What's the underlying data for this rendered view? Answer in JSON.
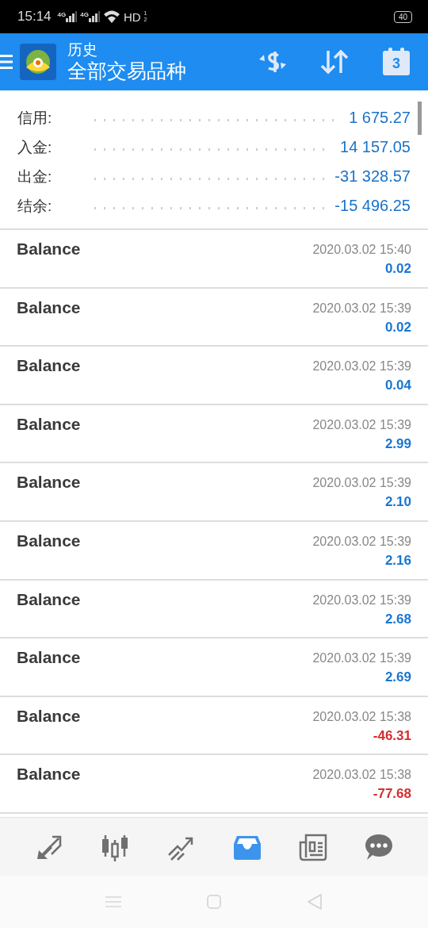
{
  "status_bar": {
    "time": "15:14",
    "signals": [
      "4G",
      "4G"
    ],
    "hd": "HD",
    "sims": [
      "1",
      "2"
    ],
    "battery": "40"
  },
  "header": {
    "title": "历史",
    "subtitle": "全部交易品种",
    "calendar_day": "3"
  },
  "summary": [
    {
      "label": "信用:",
      "value": "1 675.27"
    },
    {
      "label": "入金:",
      "value": "14 157.05"
    },
    {
      "label": "出金:",
      "value": "-31 328.57"
    },
    {
      "label": "结余:",
      "value": "-15 496.25"
    }
  ],
  "deals": [
    {
      "type": "Balance",
      "time": "2020.03.02 15:40",
      "amount": "0.02",
      "color": "#1976d2"
    },
    {
      "type": "Balance",
      "time": "2020.03.02 15:39",
      "amount": "0.02",
      "color": "#1976d2"
    },
    {
      "type": "Balance",
      "time": "2020.03.02 15:39",
      "amount": "0.04",
      "color": "#1976d2"
    },
    {
      "type": "Balance",
      "time": "2020.03.02 15:39",
      "amount": "2.99",
      "color": "#1976d2"
    },
    {
      "type": "Balance",
      "time": "2020.03.02 15:39",
      "amount": "2.10",
      "color": "#1976d2"
    },
    {
      "type": "Balance",
      "time": "2020.03.02 15:39",
      "amount": "2.16",
      "color": "#1976d2"
    },
    {
      "type": "Balance",
      "time": "2020.03.02 15:39",
      "amount": "2.68",
      "color": "#1976d2"
    },
    {
      "type": "Balance",
      "time": "2020.03.02 15:39",
      "amount": "2.69",
      "color": "#1976d2"
    },
    {
      "type": "Balance",
      "time": "2020.03.02 15:38",
      "amount": "-46.31",
      "color": "#d32f2f"
    },
    {
      "type": "Balance",
      "time": "2020.03.02 15:38",
      "amount": "-77.68",
      "color": "#d32f2f"
    }
  ],
  "bottom_tabs": [
    {
      "selected": false
    },
    {
      "selected": false
    },
    {
      "selected": false
    },
    {
      "selected": true
    },
    {
      "selected": false
    },
    {
      "selected": false
    }
  ]
}
